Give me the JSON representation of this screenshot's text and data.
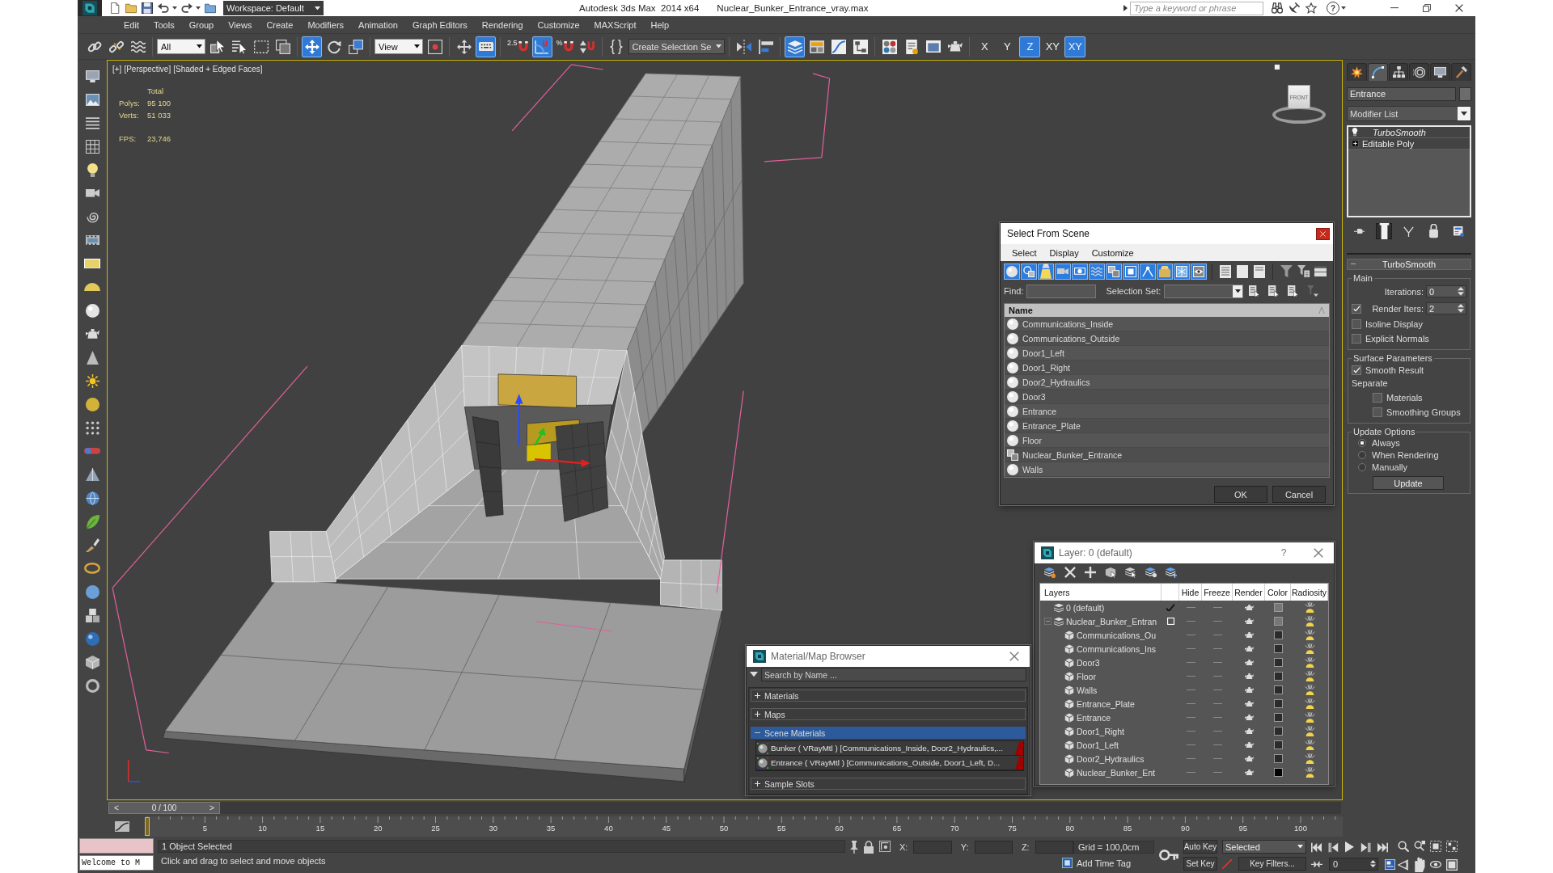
{
  "title_bar": {
    "workspace": "Workspace: Default",
    "app_title": "Autodesk 3ds Max  2014 x64",
    "file_name": "Nuclear_Bunker_Entrance_vray.max",
    "search": {
      "placeholder": "Type a keyword or phrase"
    },
    "help": "?"
  },
  "menu": [
    "Edit",
    "Tools",
    "Group",
    "Views",
    "Create",
    "Modifiers",
    "Animation",
    "Graph Editors",
    "Rendering",
    "Customize",
    "MAXScript",
    "Help"
  ],
  "toolbar": [
    [
      {
        "kind": "link",
        "active": false
      },
      {
        "kind": "unlink",
        "active": false
      },
      {
        "kind": "bind",
        "active": false
      }
    ],
    [
      {
        "kind": "dropdown",
        "value": "All",
        "active": false
      },
      {
        "kind": "select",
        "active": false
      },
      {
        "kind": "select_by_name",
        "active": false
      },
      {
        "kind": "region",
        "active": false
      },
      {
        "kind": "crossing",
        "active": false
      }
    ],
    [
      {
        "kind": "move",
        "active": true
      },
      {
        "kind": "rotate",
        "active": false
      },
      {
        "kind": "scale",
        "active": false
      }
    ],
    [
      {
        "kind": "dropdown",
        "value": "View",
        "active": false
      },
      {
        "kind": "pivot",
        "active": false
      }
    ],
    [
      {
        "kind": "manipulate",
        "active": false
      },
      {
        "kind": "keyboard",
        "active": true
      }
    ],
    [
      {
        "kind": "snap",
        "label": "2.5",
        "active": false
      },
      {
        "kind": "angle_snap",
        "active": true
      },
      {
        "kind": "percent_snap",
        "label": "%",
        "active": false
      },
      {
        "kind": "spinner_snap",
        "active": false
      }
    ],
    [
      {
        "kind": "named_sets",
        "active": false
      },
      {
        "kind": "combo",
        "value": "Create Selection Se",
        "active": false
      }
    ],
    [
      {
        "kind": "mirror",
        "active": false
      },
      {
        "kind": "align",
        "active": false
      }
    ],
    [
      {
        "kind": "layers",
        "active": true
      },
      {
        "kind": "ribbon",
        "active": false
      },
      {
        "kind": "curve_editor",
        "active": false
      },
      {
        "kind": "schematic",
        "active": false
      }
    ],
    [
      {
        "kind": "material_editor",
        "active": false
      },
      {
        "kind": "render_setup",
        "active": false
      },
      {
        "kind": "frame_window",
        "active": false
      },
      {
        "kind": "render",
        "active": false
      }
    ],
    [
      {
        "kind": "axis",
        "label": "X",
        "active": false
      },
      {
        "kind": "axis",
        "label": "Y",
        "active": false
      },
      {
        "kind": "axis",
        "label": "Z",
        "active": true
      },
      {
        "kind": "axis",
        "label": "XY",
        "active": false
      },
      {
        "kind": "axis",
        "label": "XY",
        "active": true
      }
    ]
  ],
  "viewport": {
    "active": true,
    "labels": [
      "[+]",
      "[Perspective]",
      "[Shaded + Edged Faces]"
    ],
    "stats": {
      "title": "Total",
      "rows": [
        {
          "label": "Polys:",
          "value": "95 100"
        },
        {
          "label": "Verts:",
          "value": "51 033"
        }
      ],
      "fps_label": "FPS:",
      "fps": "23,746"
    },
    "viewcube": {
      "face": "FRONT"
    }
  },
  "select_dialog": {
    "title": "Select From Scene",
    "menu": [
      "Select",
      "Display",
      "Customize"
    ],
    "filters": [
      {
        "kind": "geometry",
        "on": true
      },
      {
        "kind": "shapes",
        "on": true
      },
      {
        "kind": "lights",
        "on": true
      },
      {
        "kind": "cameras",
        "on": true
      },
      {
        "kind": "helpers",
        "on": true
      },
      {
        "kind": "space_warps",
        "on": true
      },
      {
        "kind": "groups",
        "on": true
      },
      {
        "kind": "xrefs",
        "on": true
      },
      {
        "kind": "bones",
        "on": true
      },
      {
        "kind": "containers",
        "on": true
      },
      {
        "kind": "frozen",
        "on": true
      },
      {
        "kind": "hidden",
        "on": true
      }
    ],
    "find_label": "Find:",
    "selection_set_label": "Selection Set:",
    "column": "Name",
    "objects": [
      {
        "kind": "geometry",
        "name": "Communications_Inside"
      },
      {
        "kind": "geometry",
        "name": "Communications_Outside"
      },
      {
        "kind": "geometry",
        "name": "Door1_Left"
      },
      {
        "kind": "geometry",
        "name": "Door1_Right"
      },
      {
        "kind": "geometry",
        "name": "Door2_Hydraulics"
      },
      {
        "kind": "geometry",
        "name": "Door3"
      },
      {
        "kind": "geometry",
        "name": "Entrance"
      },
      {
        "kind": "geometry",
        "name": "Entrance_Plate"
      },
      {
        "kind": "geometry",
        "name": "Floor"
      },
      {
        "kind": "group",
        "name": "Nuclear_Bunker_Entrance"
      },
      {
        "kind": "geometry",
        "name": "Walls"
      }
    ],
    "buttons": [
      "OK",
      "Cancel"
    ]
  },
  "layer_dialog": {
    "title": "Layer: 0 (default)",
    "help": "?",
    "columns": [
      "Layers",
      "Hide",
      "Freeze",
      "Render",
      "Color",
      "Radiosity"
    ],
    "layers": [
      {
        "name": "0 (default)",
        "current": true,
        "hidden": false,
        "frozen": false,
        "color": "#777777"
      },
      {
        "name": "Nuclear_Bunker_Entran",
        "current": false,
        "expanded": true,
        "hidden": false,
        "frozen": false,
        "color": "#777777",
        "children": [
          {
            "name": "Communications_Ou",
            "hidden": false,
            "frozen": false,
            "color": "#2b2b2b"
          },
          {
            "name": "Communications_Ins",
            "hidden": false,
            "frozen": false,
            "color": "#2b2b2b"
          },
          {
            "name": "Door3",
            "hidden": false,
            "frozen": false,
            "color": "#2b2b2b"
          },
          {
            "name": "Floor",
            "hidden": false,
            "frozen": false,
            "color": "#2b2b2b"
          },
          {
            "name": "Walls",
            "hidden": false,
            "frozen": false,
            "color": "#2b2b2b"
          },
          {
            "name": "Entrance_Plate",
            "hidden": false,
            "frozen": false,
            "color": "#2b2b2b"
          },
          {
            "name": "Entrance",
            "hidden": false,
            "frozen": false,
            "color": "#2b2b2b"
          },
          {
            "name": "Door1_Right",
            "hidden": false,
            "frozen": false,
            "color": "#2b2b2b"
          },
          {
            "name": "Door1_Left",
            "hidden": false,
            "frozen": false,
            "color": "#2b2b2b"
          },
          {
            "name": "Door2_Hydraulics",
            "hidden": false,
            "frozen": false,
            "color": "#2b2b2b"
          },
          {
            "name": "Nuclear_Bunker_Ent",
            "hidden": false,
            "frozen": false,
            "color": "#000000"
          }
        ]
      }
    ]
  },
  "material_browser": {
    "title": "Material/Map Browser",
    "search": {
      "placeholder": "Search by Name ..."
    },
    "groups": [
      {
        "title": "Materials",
        "expanded": false,
        "selected": false
      },
      {
        "title": "Maps",
        "expanded": false,
        "selected": false
      },
      {
        "title": "Scene Materials",
        "expanded": true,
        "selected": true,
        "items": [
          "Bunker ( VRayMtl ) [Communications_Inside, Door2_Hydraulics,...",
          "Entrance ( VRayMtl ) [Communications_Outside, Door1_Left, D..."
        ]
      },
      {
        "title": "Sample Slots",
        "expanded": false,
        "selected": false
      }
    ]
  },
  "command_panel": {
    "tabs": [
      {
        "kind": "create",
        "selected": false
      },
      {
        "kind": "modify",
        "selected": true
      },
      {
        "kind": "hierarchy",
        "selected": false
      },
      {
        "kind": "motion",
        "selected": false
      },
      {
        "kind": "display",
        "selected": false
      },
      {
        "kind": "utilities",
        "selected": false
      }
    ],
    "object_name": "Entrance",
    "modifier_list": "Modifier List",
    "stack": [
      {
        "kind": "modifier",
        "name": "TurboSmooth",
        "enabled": true
      },
      {
        "kind": "base",
        "name": "Editable Poly",
        "expanded": false
      }
    ],
    "stack_buttons": [
      {
        "kind": "pin",
        "active": false
      },
      {
        "kind": "end_result",
        "active": true
      },
      {
        "kind": "make_unique",
        "active": false
      },
      {
        "kind": "remove",
        "active": false
      },
      {
        "kind": "configure",
        "active": false
      }
    ],
    "rollout": {
      "title": "TurboSmooth",
      "expanded": true,
      "groups": [
        {
          "title": "Main",
          "controls": [
            {
              "kind": "spinner",
              "label": "Iterations:",
              "value": "0"
            },
            {
              "kind": "check_spinner",
              "label": "Render Iters:",
              "value": "2",
              "checked": true
            },
            {
              "kind": "checkbox",
              "label": "Isoline Display",
              "checked": false
            },
            {
              "kind": "checkbox",
              "label": "Explicit Normals",
              "checked": false
            }
          ]
        },
        {
          "title": "Surface Parameters",
          "controls": [
            {
              "kind": "checkbox",
              "label": "Smooth Result",
              "checked": true
            },
            {
              "kind": "label",
              "label": "Separate",
              "children": [
                {
                  "kind": "checkbox",
                  "label": "Materials",
                  "checked": false
                },
                {
                  "kind": "checkbox",
                  "label": "Smoothing Groups",
                  "checked": false
                }
              ]
            }
          ]
        },
        {
          "title": "Update Options",
          "controls": [
            {
              "kind": "radio",
              "label": "Always",
              "selected": true
            },
            {
              "kind": "radio",
              "label": "When Rendering",
              "selected": false
            },
            {
              "kind": "radio",
              "label": "Manually",
              "selected": false
            },
            {
              "kind": "button",
              "label": "Update"
            }
          ]
        }
      ]
    }
  },
  "time_slider": {
    "prev": "<",
    "label": "0 / 100",
    "next": ">",
    "level": 0
  },
  "track_bar": {
    "ticks": [
      "5",
      "10",
      "15",
      "20",
      "25",
      "30",
      "35",
      "40",
      "45",
      "50",
      "55",
      "60",
      "65",
      "70",
      "75",
      "80",
      "85",
      "90",
      "95",
      "100"
    ]
  },
  "status": {
    "listener_output": "Welcome to M",
    "selection": "1 Object Selected",
    "prompt": "Click and drag to select and move objects",
    "coords": [
      "X:",
      "Y:",
      "Z:"
    ],
    "grid": "Grid = 100,0cm",
    "time_tag": "Add Time Tag",
    "auto_key": {
      "label": "Auto Key",
      "on": false
    },
    "set_key": "Set Key",
    "key_mode": "Selected",
    "key_filters": "Key Filters...",
    "frame": "0"
  }
}
